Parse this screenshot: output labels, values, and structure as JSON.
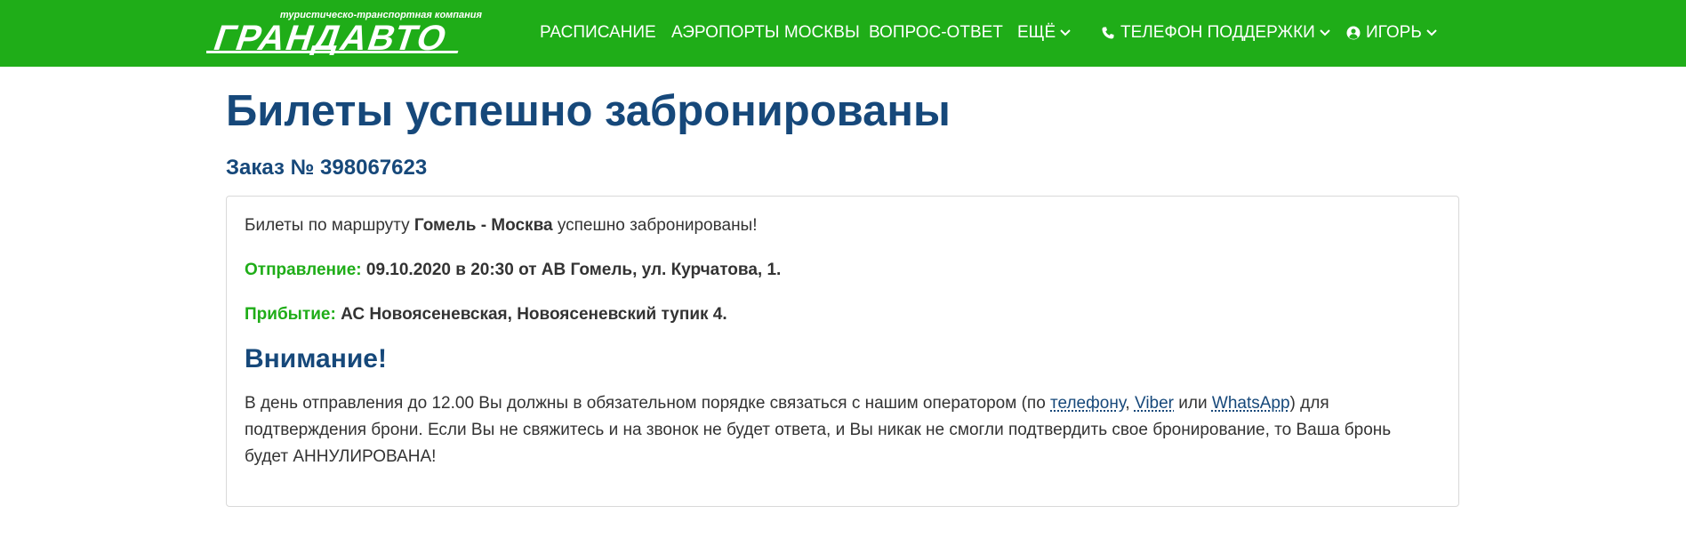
{
  "header": {
    "logo": {
      "tagline": "туристическо-транспортная компания",
      "brand": "ГРАНДАВТО"
    },
    "nav": {
      "schedule": "РАСПИСАНИЕ",
      "airports": "АЭРОПОРТЫ МОСКВЫ",
      "faq": "ВОПРОС-ОТВЕТ",
      "more": "ЕЩЁ",
      "support_phone": "ТЕЛЕФОН ПОДДЕРЖКИ",
      "user": "ИГОРЬ"
    },
    "icons": {
      "phone": "phone-icon",
      "user": "user-circle-icon",
      "dropdown": "chevron-down-icon"
    },
    "colors": {
      "navbar_bg": "#1fad18",
      "heading": "#16487a",
      "label_green": "#1fad18"
    }
  },
  "main": {
    "title": "Билеты успешно забронированы",
    "order_number": "Заказ № 398067623",
    "panel": {
      "route_prefix": "Билеты по маршруту",
      "route": "Гомель - Москва",
      "route_suffix": "успешно забронированы!",
      "departure_label": "Отправление:",
      "departure_value": "09.10.2020 в 20:30 от АВ Гомель, ул. Курчатова, 1.",
      "arrival_label": "Прибытие:",
      "arrival_value": "АС Новоясеневская, Новоясеневский тупик 4.",
      "warning_title": "Внимание!",
      "warning_text_1": "В день отправления до 12.00 Вы должны в обязательном порядке связаться с нашим оператором (по",
      "link_phone": "телефону",
      "sep_comma": ",",
      "link_viber": "Viber",
      "word_or": "или",
      "link_whatsapp": "WhatsApp",
      "warning_text_2": ") для подтверждения брони. Если Вы не свяжитесь и на звонок не будет ответа, и Вы никак не смогли подтвердить свое бронирование, то Ваша бронь будет АННУЛИРОВАНА!"
    }
  }
}
